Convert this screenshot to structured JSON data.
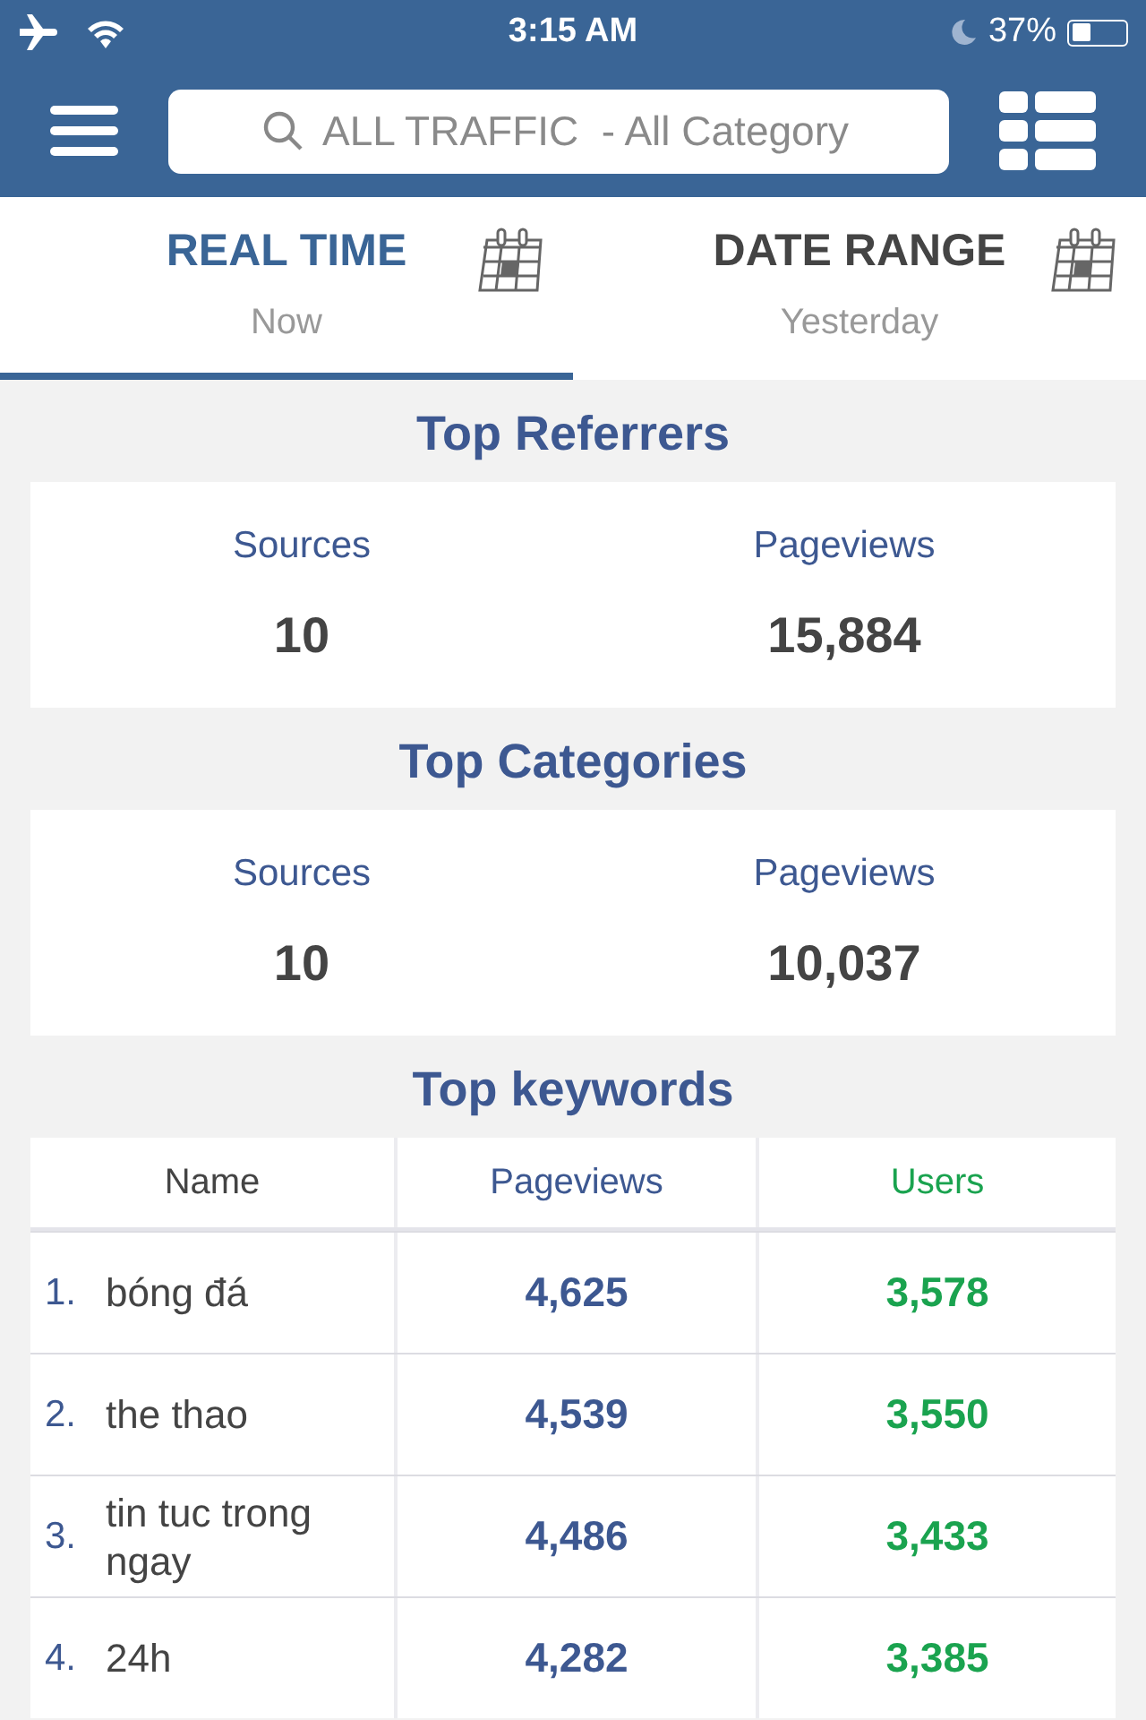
{
  "status_bar": {
    "time": "3:15 AM",
    "battery": "37%"
  },
  "search": {
    "placeholder": "ALL TRAFFIC  - All Category"
  },
  "tabs": [
    {
      "title": "REAL TIME",
      "subtitle": "Now",
      "selected": true
    },
    {
      "title": "DATE RANGE",
      "subtitle": "Yesterday",
      "selected": false
    }
  ],
  "summaries": [
    {
      "title": "Top Referrers",
      "columns": [
        {
          "label": "Sources",
          "value": "10"
        },
        {
          "label": "Pageviews",
          "value": "15,884"
        }
      ]
    },
    {
      "title": "Top Categories",
      "columns": [
        {
          "label": "Sources",
          "value": "10"
        },
        {
          "label": "Pageviews",
          "value": "10,037"
        }
      ]
    }
  ],
  "keywords": {
    "title": "Top keywords",
    "columns": [
      "Name",
      "Pageviews",
      "Users"
    ],
    "rows": [
      {
        "rank": "1.",
        "name": "bóng đá",
        "pageviews": "4,625",
        "users": "3,578"
      },
      {
        "rank": "2.",
        "name": "the thao",
        "pageviews": "4,539",
        "users": "3,550"
      },
      {
        "rank": "3.",
        "name": "tin tuc trong ngay",
        "pageviews": "4,486",
        "users": "3,433"
      },
      {
        "rank": "4.",
        "name": "24h",
        "pageviews": "4,282",
        "users": "3,385"
      }
    ]
  }
}
